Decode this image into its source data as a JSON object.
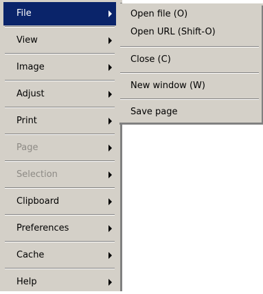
{
  "main_menu": {
    "items": [
      {
        "label": "File",
        "state": "highlighted",
        "has_submenu": true
      },
      {
        "label": "View",
        "state": "normal",
        "has_submenu": true
      },
      {
        "label": "Image",
        "state": "normal",
        "has_submenu": true
      },
      {
        "label": "Adjust",
        "state": "normal",
        "has_submenu": true
      },
      {
        "label": "Print",
        "state": "normal",
        "has_submenu": true
      },
      {
        "label": "Page",
        "state": "disabled",
        "has_submenu": true
      },
      {
        "label": "Selection",
        "state": "disabled",
        "has_submenu": true
      },
      {
        "label": "Clipboard",
        "state": "normal",
        "has_submenu": true
      },
      {
        "label": "Preferences",
        "state": "normal",
        "has_submenu": true
      },
      {
        "label": "Cache",
        "state": "normal",
        "has_submenu": true
      },
      {
        "label": "Help",
        "state": "normal",
        "has_submenu": true
      }
    ]
  },
  "file_submenu": {
    "items": [
      {
        "label": "Open file (O)"
      },
      {
        "label": "Open URL (Shift-O)"
      },
      {
        "label": "Close (C)"
      },
      {
        "label": "New window (W)"
      },
      {
        "label": "Save page"
      }
    ]
  },
  "colors": {
    "menu_bg": "#d4d0c8",
    "highlight_bg": "#0a246a",
    "highlight_text": "#ffffff",
    "disabled_text": "#8d8a85",
    "shadow": "#808080"
  },
  "icons": [
    "submenu-arrow-icon"
  ]
}
